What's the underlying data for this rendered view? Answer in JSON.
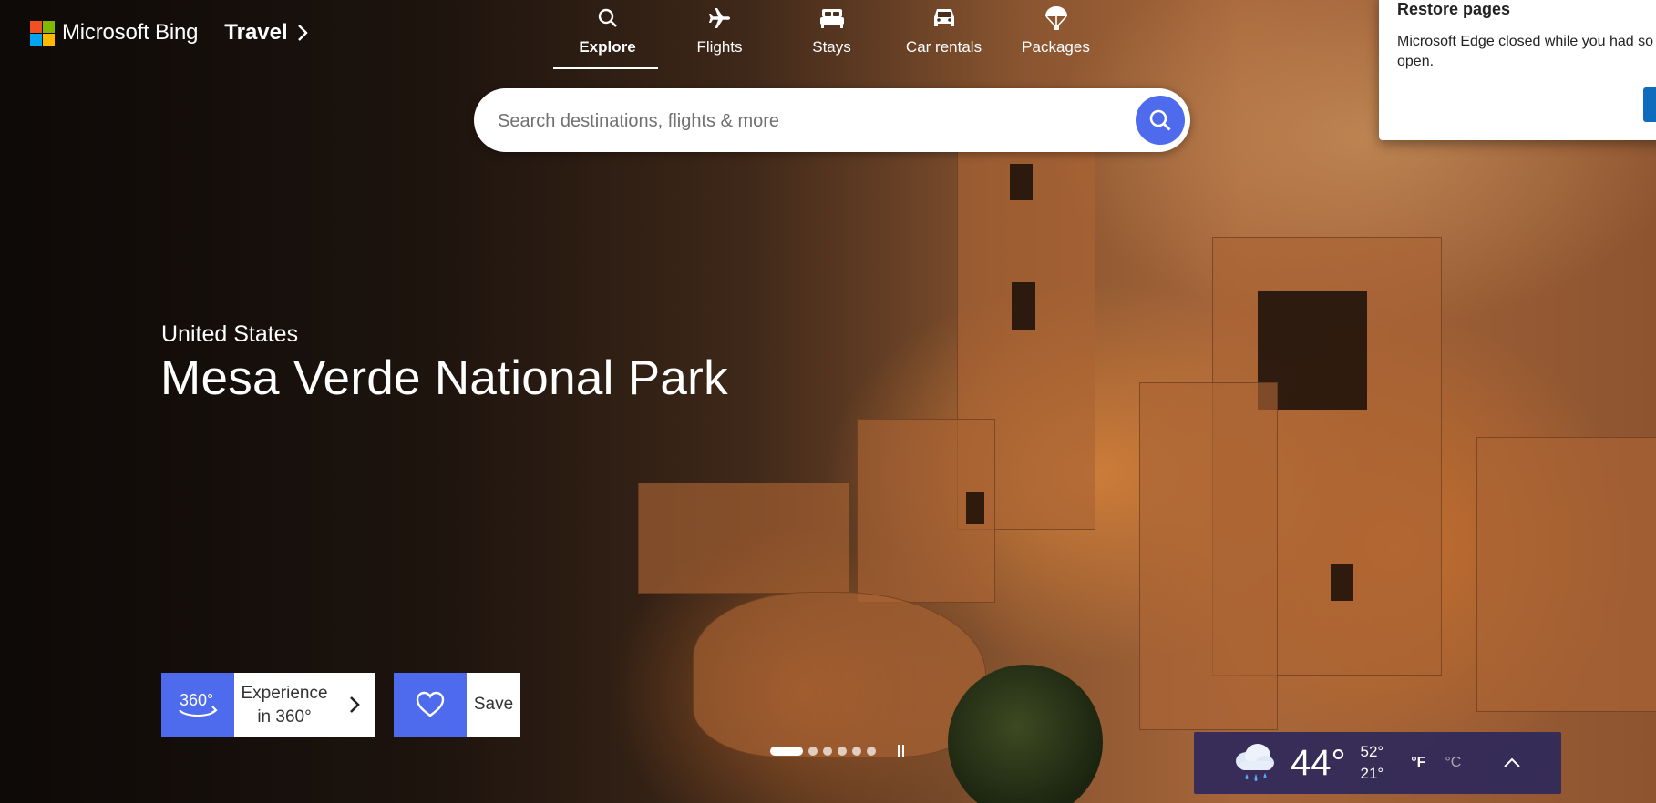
{
  "header": {
    "brand_name": "Microsoft Bing",
    "section_label": "Travel",
    "section_chevron": ">",
    "ms_logo_colors": [
      "#f25022",
      "#7fba00",
      "#00a4ef",
      "#ffb900"
    ]
  },
  "nav": {
    "items": [
      {
        "label": "Explore",
        "icon": "search-icon",
        "active": true
      },
      {
        "label": "Flights",
        "icon": "airplane-icon",
        "active": false
      },
      {
        "label": "Stays",
        "icon": "bed-icon",
        "active": false
      },
      {
        "label": "Car rentals",
        "icon": "car-icon",
        "active": false
      },
      {
        "label": "Packages",
        "icon": "parachute-icon",
        "active": false
      }
    ]
  },
  "search": {
    "placeholder": "Search destinations, flights & more",
    "value": "",
    "button_icon": "search-icon",
    "accent": "#4f6bed"
  },
  "restore_popup": {
    "title": "Restore pages",
    "message": "Microsoft Edge closed while you had so",
    "message_cont": "open."
  },
  "hero": {
    "country": "United States",
    "title": "Mesa Verde National Park"
  },
  "actions": {
    "experience_360": {
      "icon_label": "360°",
      "label_line1": "Experience",
      "label_line2": "in 360°",
      "chevron": ">"
    },
    "save": {
      "icon": "heart-icon",
      "label": "Save"
    }
  },
  "carousel": {
    "count": 6,
    "active_index": 0
  },
  "weather": {
    "icon": "rain-cloud-icon",
    "temperature": "44°",
    "high": "52°",
    "low": "21°",
    "unit_f": "°F",
    "unit_c": "°C",
    "active_unit": "F",
    "expand_icon": "chevron-up-icon"
  }
}
